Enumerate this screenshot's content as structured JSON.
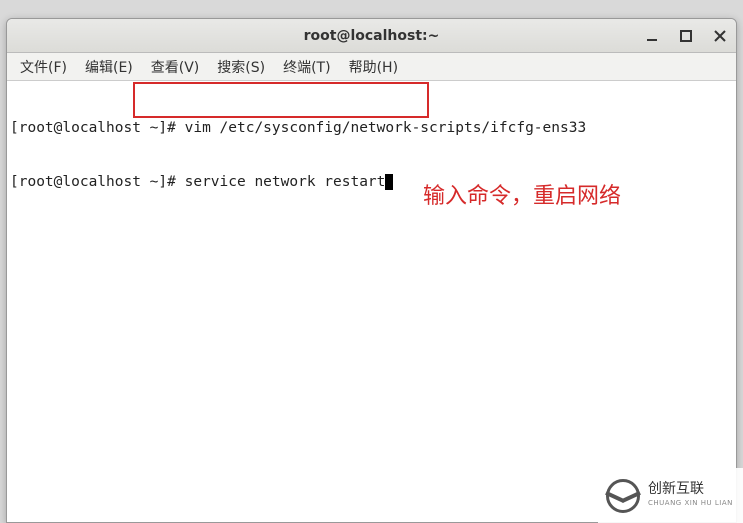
{
  "window": {
    "title": "root@localhost:~"
  },
  "menu": {
    "file": "文件(F)",
    "edit": "编辑(E)",
    "view": "查看(V)",
    "search": "搜索(S)",
    "terminal": "终端(T)",
    "help": "帮助(H)"
  },
  "terminal": {
    "line1_prompt": "[root@localhost ~]# ",
    "line1_cmd": "vim /etc/sysconfig/network-scripts/ifcfg-ens33",
    "line2_prompt": "[root@localhost ~]# ",
    "line2_cmd": "service network restart"
  },
  "annotation": {
    "text": "输入命令，重启网络"
  },
  "watermark": {
    "cn": "创新互联",
    "en": "CHUANG XIN HU LIAN"
  }
}
